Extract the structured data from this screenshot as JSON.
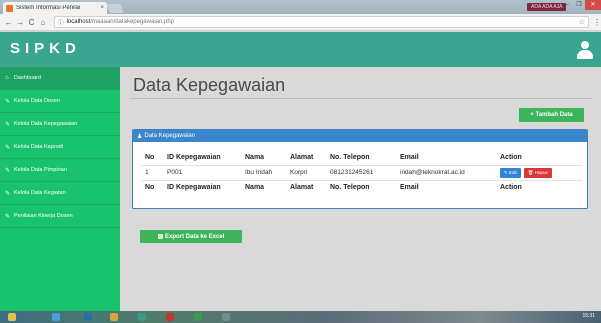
{
  "browser": {
    "tab_title": "Sistem Informasi Penilai",
    "tab_close": "×",
    "user_chip": "ADA ADA AJA",
    "win_min": "–",
    "win_max": "❐",
    "win_close": "✕",
    "url_host": "localhost",
    "url_path": "/maaaan/datakepegawaian.php",
    "back": "←",
    "forward": "→",
    "reload": "C",
    "home": "⌂",
    "info": "ⓘ",
    "star": "☆",
    "menu": "⋮"
  },
  "app": {
    "brand": "SIPKD"
  },
  "sidebar": {
    "items": [
      {
        "label": "Dashboard",
        "icon": "⌂"
      },
      {
        "label": "Kelola Data Dosen",
        "icon": "✎"
      },
      {
        "label": "Kelola Data Kepegawaian",
        "icon": "✎"
      },
      {
        "label": "Kelola Data Kaprodi",
        "icon": "✎"
      },
      {
        "label": "Kelola Data Pimpinan",
        "icon": "✎"
      },
      {
        "label": "Kelola Data Kegiatan",
        "icon": "✎"
      },
      {
        "label": "Penilaian Kinerja Dosen",
        "icon": "✎"
      }
    ]
  },
  "main": {
    "title": "Data Kepegawaian",
    "add_button": "+ Tambah Data",
    "panel_title": "Data Kepegawaian",
    "panel_icon": "♟",
    "columns": [
      "No",
      "ID Kepegawaian",
      "Nama",
      "Alamat",
      "No. Telepon",
      "Email",
      "Action"
    ],
    "rows": [
      {
        "no": "1",
        "id": "P001",
        "nama": "Ibu Indah",
        "alamat": "Korpri",
        "telepon": "081231245261",
        "email": "indah@teknokrat.ac.id"
      }
    ],
    "edit_label": "✎ Edit",
    "delete_label": "🗑 Hapus",
    "export_button": "▤ Export Data ke Excel"
  },
  "taskbar": {
    "clock": "15:31"
  },
  "colors": {
    "header": "#3aa58f",
    "sidebar": "#19c26c",
    "success": "#3db35a",
    "primary": "#3a86cc",
    "danger": "#d9383a"
  }
}
